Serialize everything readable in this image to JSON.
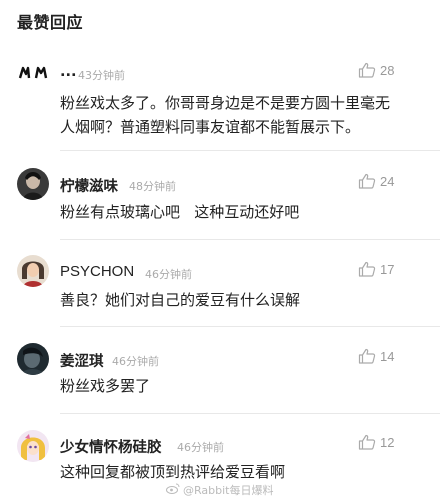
{
  "section": {
    "title": "最赞回应"
  },
  "comments": [
    {
      "user": "...",
      "time": "43分钟前",
      "likes": "28",
      "text": "粉丝戏太多了。你哥哥身边是不是要方圆十里毫无人烟啊？普通塑料同事友谊都不能暂展示下。"
    },
    {
      "user": "柠檬滋味",
      "time": "48分钟前",
      "likes": "24",
      "text": "粉丝有点玻璃心吧   这种互动还好吧"
    },
    {
      "user": "PSYCHON",
      "time": "46分钟前",
      "likes": "17",
      "text": "善良？她们对自己的爱豆有什么误解"
    },
    {
      "user": "姜涩琪",
      "time": "46分钟前",
      "likes": "14",
      "text": "粉丝戏多罢了"
    },
    {
      "user": "少女情怀杨硅胶",
      "time": "46分钟前",
      "likes": "12",
      "text": "这种回复都被顶到热评给爱豆看啊"
    }
  ],
  "watermark": {
    "text": "@Rabbit每日爆料"
  }
}
